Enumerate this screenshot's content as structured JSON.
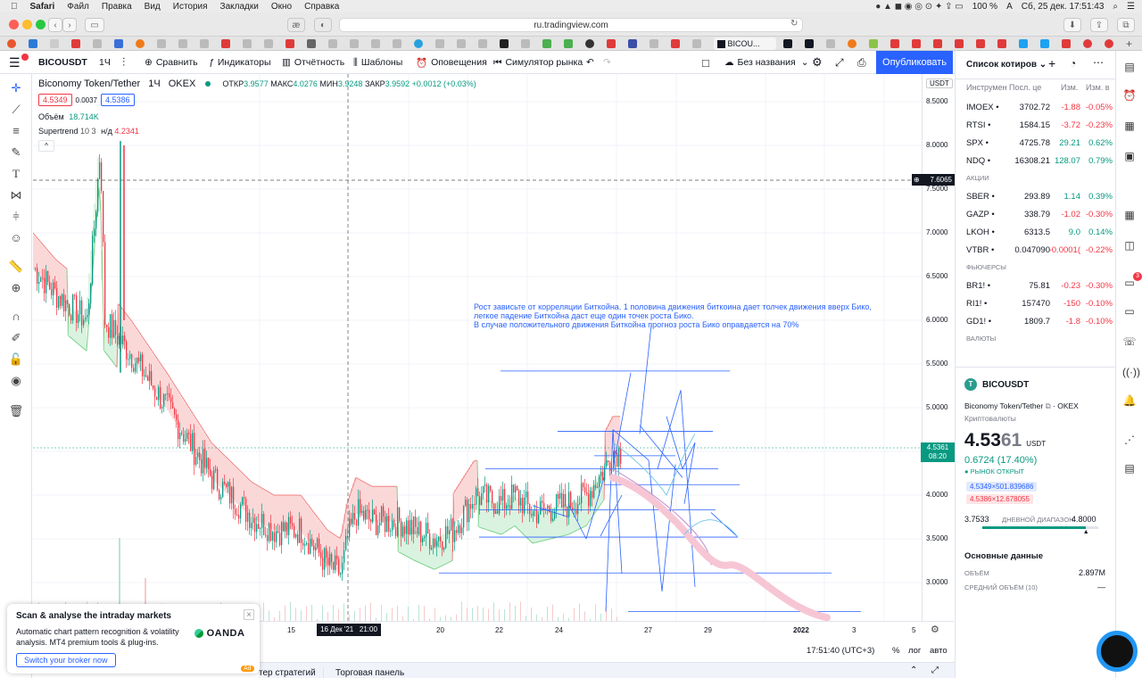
{
  "mac_menubar": {
    "app": "Safari",
    "items": [
      "Файл",
      "Правка",
      "Вид",
      "История",
      "Закладки",
      "Окно",
      "Справка"
    ],
    "battery": "100 %",
    "keyboard": "A",
    "clock": "Сб, 25 дек.  17:51:43"
  },
  "safari": {
    "url": "ru.tradingview.com",
    "tab_label": "BICOU..."
  },
  "topbar": {
    "symbol": "BICOUSDT",
    "interval": "1Ч",
    "compare": "Сравнить",
    "indicators": "Индикаторы",
    "reports": "Отчётность",
    "templates": "Шаблоны",
    "alerts": "Оповещения",
    "simulator": "Симулятор рынка",
    "layout_name": "Без названия",
    "publish": "Опубликовать"
  },
  "legend": {
    "title": "Biconomy Token/Tether",
    "interval": "1Ч",
    "exchange": "OKEX",
    "o_label": "ОТКР",
    "o": "3.9577",
    "h_label": "МАКС",
    "h": "4.0276",
    "l_label": "МИН",
    "l": "3.9248",
    "c_label": "ЗАКР",
    "c": "3.9592",
    "change": "+0.0012 (+0.03%)",
    "bid": "4.5349",
    "spread": "0.0037",
    "ask": "4.5386",
    "volume_label": "Объём",
    "volume": "18.714K",
    "supertrend_label": "Supertrend",
    "supertrend_params": "10 3",
    "supertrend_na": "н/д",
    "supertrend_value": "4.2341"
  },
  "annotation": [
    "Рост зависьте от корреляции Биткойна. 1 половина движения биткоина дает толчек движения вверх Бико,",
    "легкое падение Биткойна даст еще один точек роста Бико.",
    "В случае положительного движения Биткойна прогноз роста Бико оправдается на 70%"
  ],
  "price_axis": {
    "currency": "USDT",
    "ticks": [
      "8.5000",
      "8.0000",
      "7.5000",
      "7.0000",
      "6.5000",
      "6.0000",
      "5.5000",
      "5.0000",
      "4.5000",
      "4.0000",
      "3.5000",
      "3.0000"
    ],
    "crosshair": "7.6065",
    "last_price": "4.5361",
    "countdown": "08:20"
  },
  "time_axis": {
    "ticks": [
      "15",
      "20",
      "22",
      "24",
      "27",
      "29",
      "2022",
      "3",
      "5"
    ],
    "crosshair": "16 Дек '21   21:00"
  },
  "bottom": {
    "time": "17:51:40 (UTC+3)",
    "percent": "%",
    "log": "лог",
    "auto": "авто",
    "tabs": [
      "тер стратегий",
      "Торговая панель"
    ]
  },
  "ad": {
    "title": "Scan & analyse the intraday markets",
    "body": "Automatic chart pattern recognition & volatility analysis. MT4 premium tools & plug-ins.",
    "cta": "Switch your broker now",
    "brand": "OANDA",
    "badge": "Ad"
  },
  "watchlist": {
    "title": "Список котиров",
    "headers": [
      "Инструмен",
      "Посл. це",
      "Изм.",
      "Изм. в"
    ],
    "rows": [
      {
        "sym": "IMOEX",
        "last": "3702.72",
        "chg": "-1.88",
        "pct": "-0.05%",
        "dir": "neg"
      },
      {
        "sym": "RTSI",
        "last": "1584.15",
        "chg": "-3.72",
        "pct": "-0.23%",
        "dir": "neg"
      },
      {
        "sym": "SPX",
        "last": "4725.78",
        "chg": "29.21",
        "pct": "0.62%",
        "dir": "pos"
      },
      {
        "sym": "NDQ",
        "last": "16308.21",
        "chg": "128.07",
        "pct": "0.79%",
        "dir": "pos"
      },
      {
        "section": "АКЦИИ"
      },
      {
        "sym": "SBER",
        "last": "293.89",
        "chg": "1.14",
        "pct": "0.39%",
        "dir": "pos"
      },
      {
        "sym": "GAZP",
        "last": "338.79",
        "chg": "-1.02",
        "pct": "-0.30%",
        "dir": "neg"
      },
      {
        "sym": "LKOH",
        "last": "6313.5",
        "chg": "9.0",
        "pct": "0.14%",
        "dir": "pos"
      },
      {
        "sym": "VTBR",
        "last": "0.047090",
        "chg": "-0.0001(",
        "pct": "-0.22%",
        "dir": "neg"
      },
      {
        "section": "ФЬЮЧЕРСЫ"
      },
      {
        "sym": "BR1!",
        "last": "75.81",
        "chg": "-0.23",
        "pct": "-0.30%",
        "dir": "neg"
      },
      {
        "sym": "RI1!",
        "last": "157470",
        "chg": "-150",
        "pct": "-0.10%",
        "dir": "neg"
      },
      {
        "sym": "GD1!",
        "last": "1809.7",
        "chg": "-1.8",
        "pct": "-0.10%",
        "dir": "neg"
      },
      {
        "section": "ВАЛЮТЫ"
      }
    ]
  },
  "details": {
    "symbol": "BICOUSDT",
    "name": "Biconomy Token/Tether",
    "exchange": "OKEX",
    "type": "Криптовалюты",
    "price_main": "4.53",
    "price_tail": "61",
    "currency": "USDT",
    "change": "0.6724 (17.40%)",
    "market_status": "РЫНОК ОТКРЫТ",
    "bid_line": "4.5349×501.839686",
    "ask_line": "4.5386×12.678055",
    "range_low": "3.7533",
    "range_label": "ДНЕВНОЙ ДИАПАЗОН",
    "range_high": "4.8000",
    "range_position": 0.89,
    "fundamentals": "Основные данные",
    "volume_label": "ОБЪЁМ",
    "volume": "2.897M",
    "avg_volume_label": "СРЕДНИЙ ОБЪЁМ (10)",
    "avg_volume": "—"
  },
  "colors": {
    "accent": "#2962ff",
    "up": "#089981",
    "down": "#f23645",
    "st_fill_down": "#fbd8d8",
    "st_fill_up": "#d9f3e0",
    "drawing": "#2962ff"
  },
  "notifications_badge": "3"
}
